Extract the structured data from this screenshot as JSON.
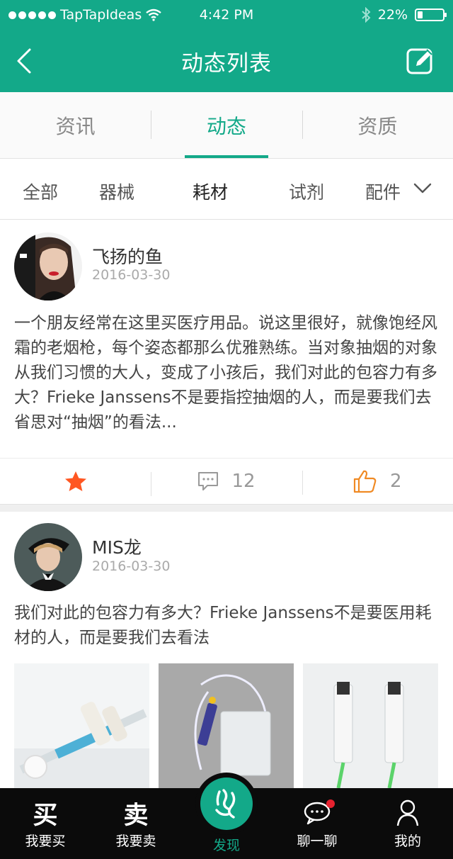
{
  "status_bar": {
    "carrier": "TapTapIdeas",
    "time": "4:42 PM",
    "battery": "22%",
    "battery_level": 0.22
  },
  "nav": {
    "title": "动态列表",
    "back_icon": "chevron-left-icon",
    "edit_icon": "edit-icon"
  },
  "top_tabs": [
    {
      "label": "资讯",
      "active": false
    },
    {
      "label": "动态",
      "active": true
    },
    {
      "label": "资质",
      "active": false
    }
  ],
  "filters": [
    {
      "label": "全部",
      "active": false
    },
    {
      "label": "器械",
      "active": false
    },
    {
      "label": "耗材",
      "active": true
    },
    {
      "label": "试剂",
      "active": false
    },
    {
      "label": "配件",
      "active": false
    }
  ],
  "posts": [
    {
      "author": "飞扬的鱼",
      "date": "2016-03-30",
      "text": "一个朋友经常在这里买医疗用品。说这里很好，就像饱经风霜的老烟枪，每个姿态都那么优雅熟练。当对象抽烟的对象从我们习惯的大人，变成了小孩后，我们对此的包容力有多大？Frieke Janssens不是要指控抽烟的人，而是要我们去省思对“抽烟”的看法...",
      "comments": "12",
      "likes": "2"
    },
    {
      "author": "MIS龙",
      "date": "2016-03-30",
      "text": "我们对此的包容力有多大？Frieke Janssens不是要医用耗材的人，而是要我们去看法"
    }
  ],
  "colors": {
    "brand": "#13a989",
    "star": "#ff5722",
    "like": "#f08a24",
    "badge": "#e6222f"
  },
  "tab_bar": [
    {
      "label": "我要买",
      "glyph": "买"
    },
    {
      "label": "我要卖",
      "glyph": "卖"
    },
    {
      "label": "发现"
    },
    {
      "label": "聊一聊"
    },
    {
      "label": "我的"
    }
  ]
}
